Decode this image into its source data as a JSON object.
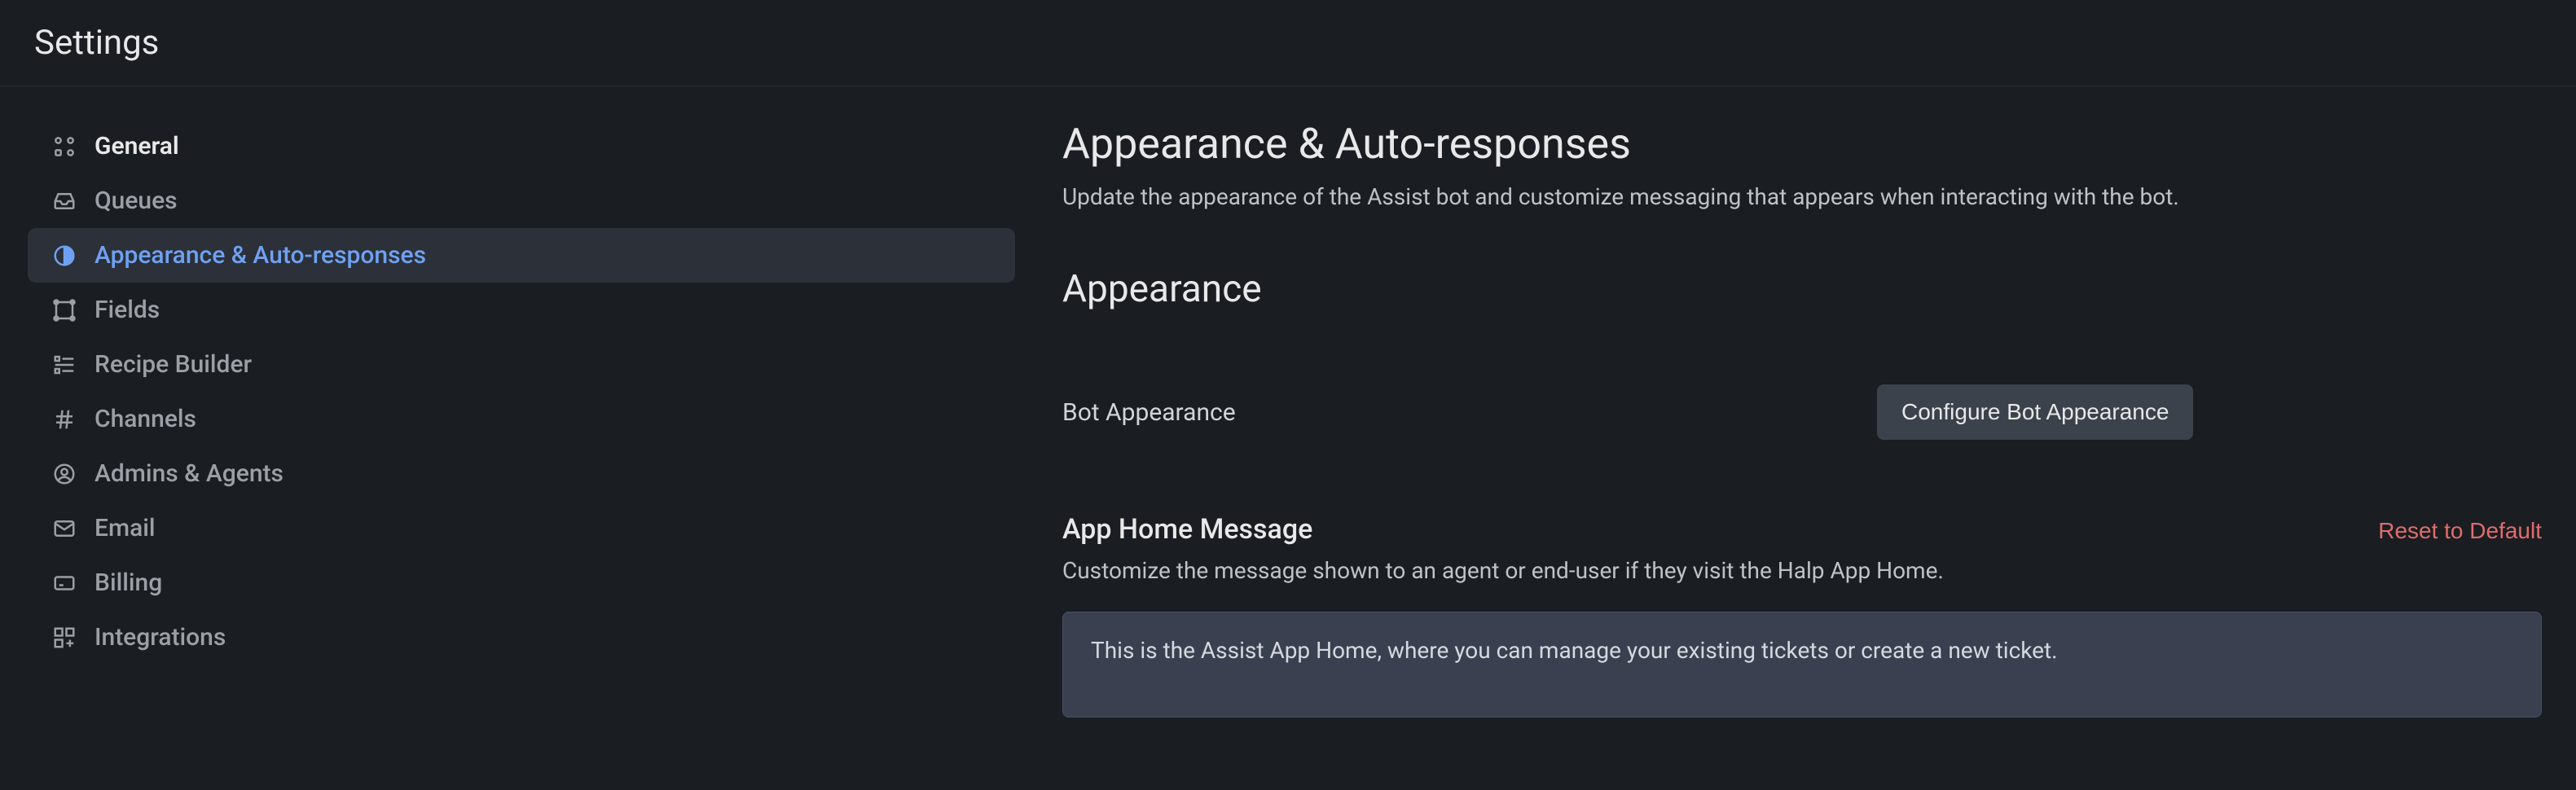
{
  "header": {
    "title": "Settings"
  },
  "sidebar": {
    "items": [
      {
        "label": "General",
        "icon": "grid-icon"
      },
      {
        "label": "Queues",
        "icon": "inbox-icon"
      },
      {
        "label": "Appearance & Auto-responses",
        "icon": "contrast-icon"
      },
      {
        "label": "Fields",
        "icon": "shape-icon"
      },
      {
        "label": "Recipe Builder",
        "icon": "list-icon"
      },
      {
        "label": "Channels",
        "icon": "hash-icon"
      },
      {
        "label": "Admins & Agents",
        "icon": "user-icon"
      },
      {
        "label": "Email",
        "icon": "mail-icon"
      },
      {
        "label": "Billing",
        "icon": "card-icon"
      },
      {
        "label": "Integrations",
        "icon": "apps-icon"
      }
    ]
  },
  "main": {
    "title": "Appearance & Auto-responses",
    "description": "Update the appearance of the Assist bot and customize messaging that appears when interacting with the bot.",
    "appearance": {
      "section_title": "Appearance",
      "bot_appearance_label": "Bot Appearance",
      "configure_button": "Configure Bot Appearance"
    },
    "app_home": {
      "title": "App Home Message",
      "reset_label": "Reset to Default",
      "description": "Customize the message shown to an agent or end-user if they visit the Halp App Home.",
      "textarea_value": "This is the Assist App Home, where you can manage your existing tickets or create a new ticket."
    }
  }
}
